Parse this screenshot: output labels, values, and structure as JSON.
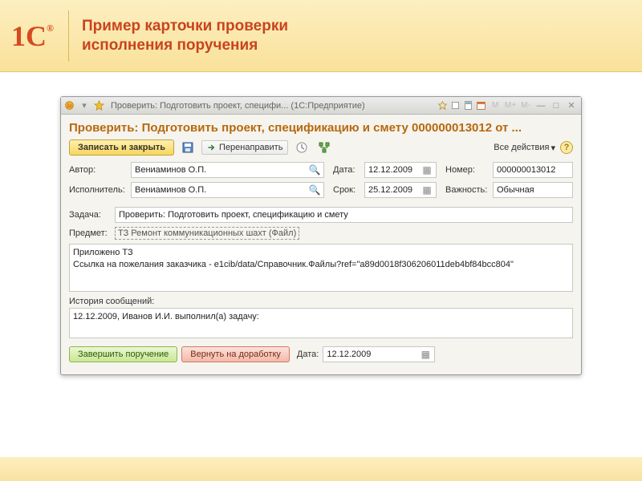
{
  "page_header": {
    "logo_text": "1С",
    "logo_reg": "®",
    "title_line1": "Пример карточки проверки",
    "title_line2": "исполнения поручения"
  },
  "window": {
    "titlebar_text": "Проверить: Подготовить проект, специфи... (1С:Предприятие)",
    "card_title": "Проверить: Подготовить проект, спецификацию и смету 000000013012 от ...",
    "toolbar": {
      "save_close": "Записать и закрыть",
      "forward": "Перенаправить",
      "all_actions": "Все действия"
    },
    "fields": {
      "author_label": "Автор:",
      "author_value": "Вениаминов О.П.",
      "executor_label": "Исполнитель:",
      "executor_value": "Вениаминов О.П.",
      "date_label": "Дата:",
      "date_value": "12.12.2009",
      "due_label": "Срок:",
      "due_value": "25.12.2009",
      "number_label": "Номер:",
      "number_value": "000000013012",
      "importance_label": "Важность:",
      "importance_value": "Обычная",
      "task_label": "Задача:",
      "task_value": "Проверить: Подготовить проект, спецификацию и смету",
      "subject_label": "Предмет:",
      "subject_link": "ТЗ Ремонт коммуникационных шахт (Файл)",
      "attachment_text": "Приложено ТЗ\nСсылка на пожелания заказчика - e1cib/data/Справочник.Файлы?ref=\"a89d0018f306206011deb4bf84bcc804\"",
      "history_label": "История сообщений:",
      "history_text": "12.12.2009, Иванов И.И. выполнил(а) задачу:"
    },
    "footer": {
      "complete": "Завершить поручение",
      "return": "Вернуть на доработку",
      "date_label": "Дата:",
      "date_value": "12.12.2009"
    }
  }
}
